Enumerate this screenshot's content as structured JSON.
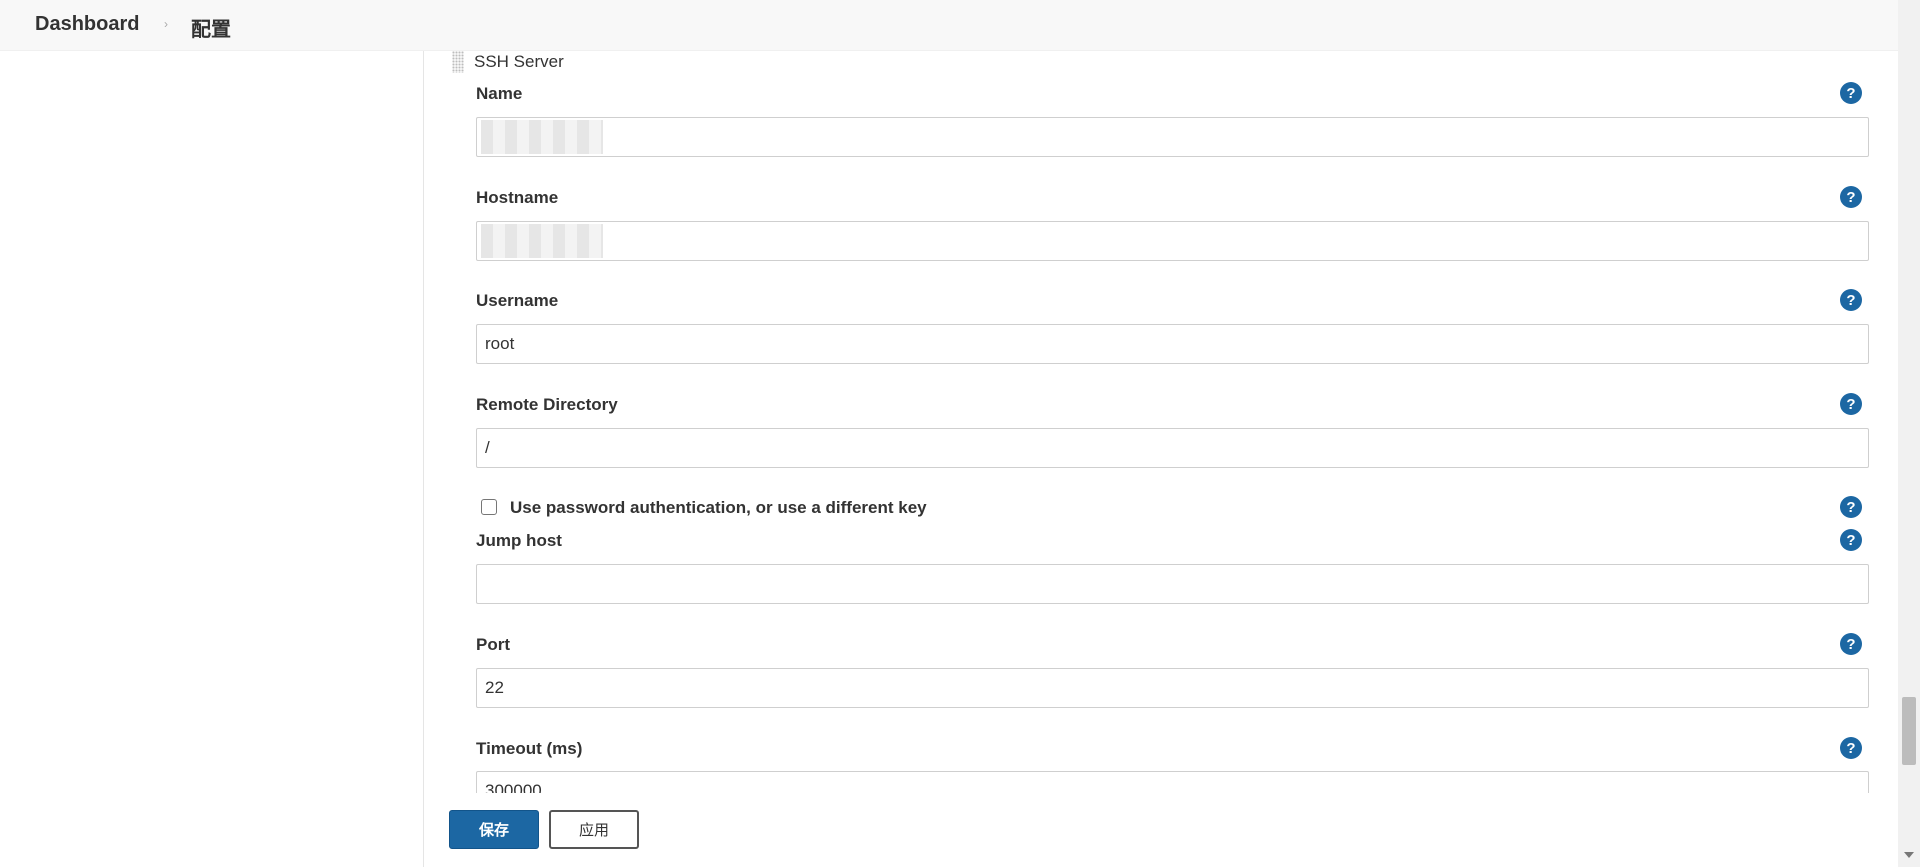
{
  "breadcrumb": {
    "dashboard": "Dashboard",
    "separator": "›",
    "current": "配置"
  },
  "section": {
    "title": "SSH Server"
  },
  "fields": {
    "name": {
      "label": "Name",
      "value": ""
    },
    "hostname": {
      "label": "Hostname",
      "value": ""
    },
    "username": {
      "label": "Username",
      "value": "root"
    },
    "remote_directory": {
      "label": "Remote Directory",
      "value": "/"
    },
    "use_password": {
      "label": "Use password authentication, or use a different key",
      "checked": false
    },
    "jump_host": {
      "label": "Jump host",
      "value": ""
    },
    "port": {
      "label": "Port",
      "value": "22"
    },
    "timeout": {
      "label": "Timeout (ms)",
      "value": "300000"
    }
  },
  "help_icon": "?",
  "buttons": {
    "save": "保存",
    "apply": "应用"
  },
  "colors": {
    "accent": "#1c67a3"
  }
}
